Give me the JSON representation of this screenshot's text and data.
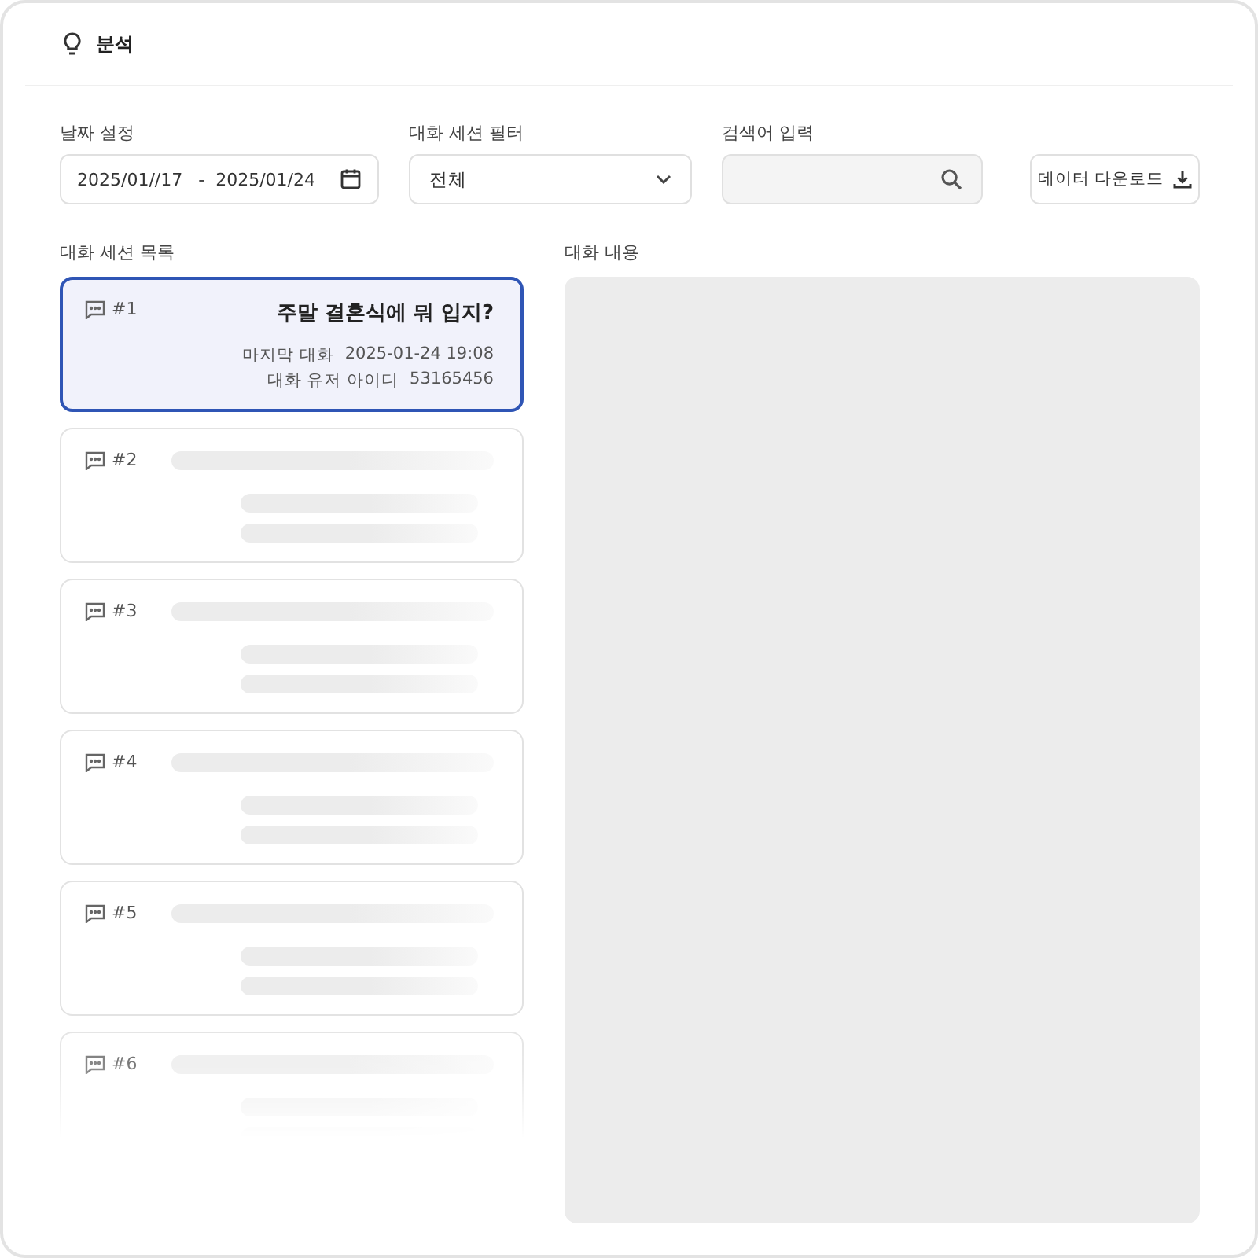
{
  "header": {
    "title": "분석"
  },
  "filters": {
    "date": {
      "label": "날짜 설정",
      "start": "2025/01//17",
      "separator": "-",
      "end": "2025/01/24"
    },
    "session_filter": {
      "label": "대화 세션 필터",
      "value": "전체"
    },
    "search": {
      "label": "검색어 입력"
    },
    "download_button": "데이터 다운로드"
  },
  "session_list": {
    "label": "대화 세션 목록",
    "sessions": [
      {
        "number": "#1",
        "kind": "loaded",
        "selected": true,
        "title": "주말 결혼식에 뭐 입지?",
        "meta": [
          {
            "label": "마지막 대화",
            "value": "2025-01-24 19:08"
          },
          {
            "label": "대화 유저 아이디",
            "value": "53165456"
          }
        ]
      },
      {
        "number": "#2",
        "kind": "loading",
        "selected": false
      },
      {
        "number": "#3",
        "kind": "loading",
        "selected": false
      },
      {
        "number": "#4",
        "kind": "loading",
        "selected": false
      },
      {
        "number": "#5",
        "kind": "loading",
        "selected": false
      },
      {
        "number": "#6",
        "kind": "loading",
        "selected": false
      }
    ]
  },
  "conversation": {
    "label": "대화 내용"
  }
}
